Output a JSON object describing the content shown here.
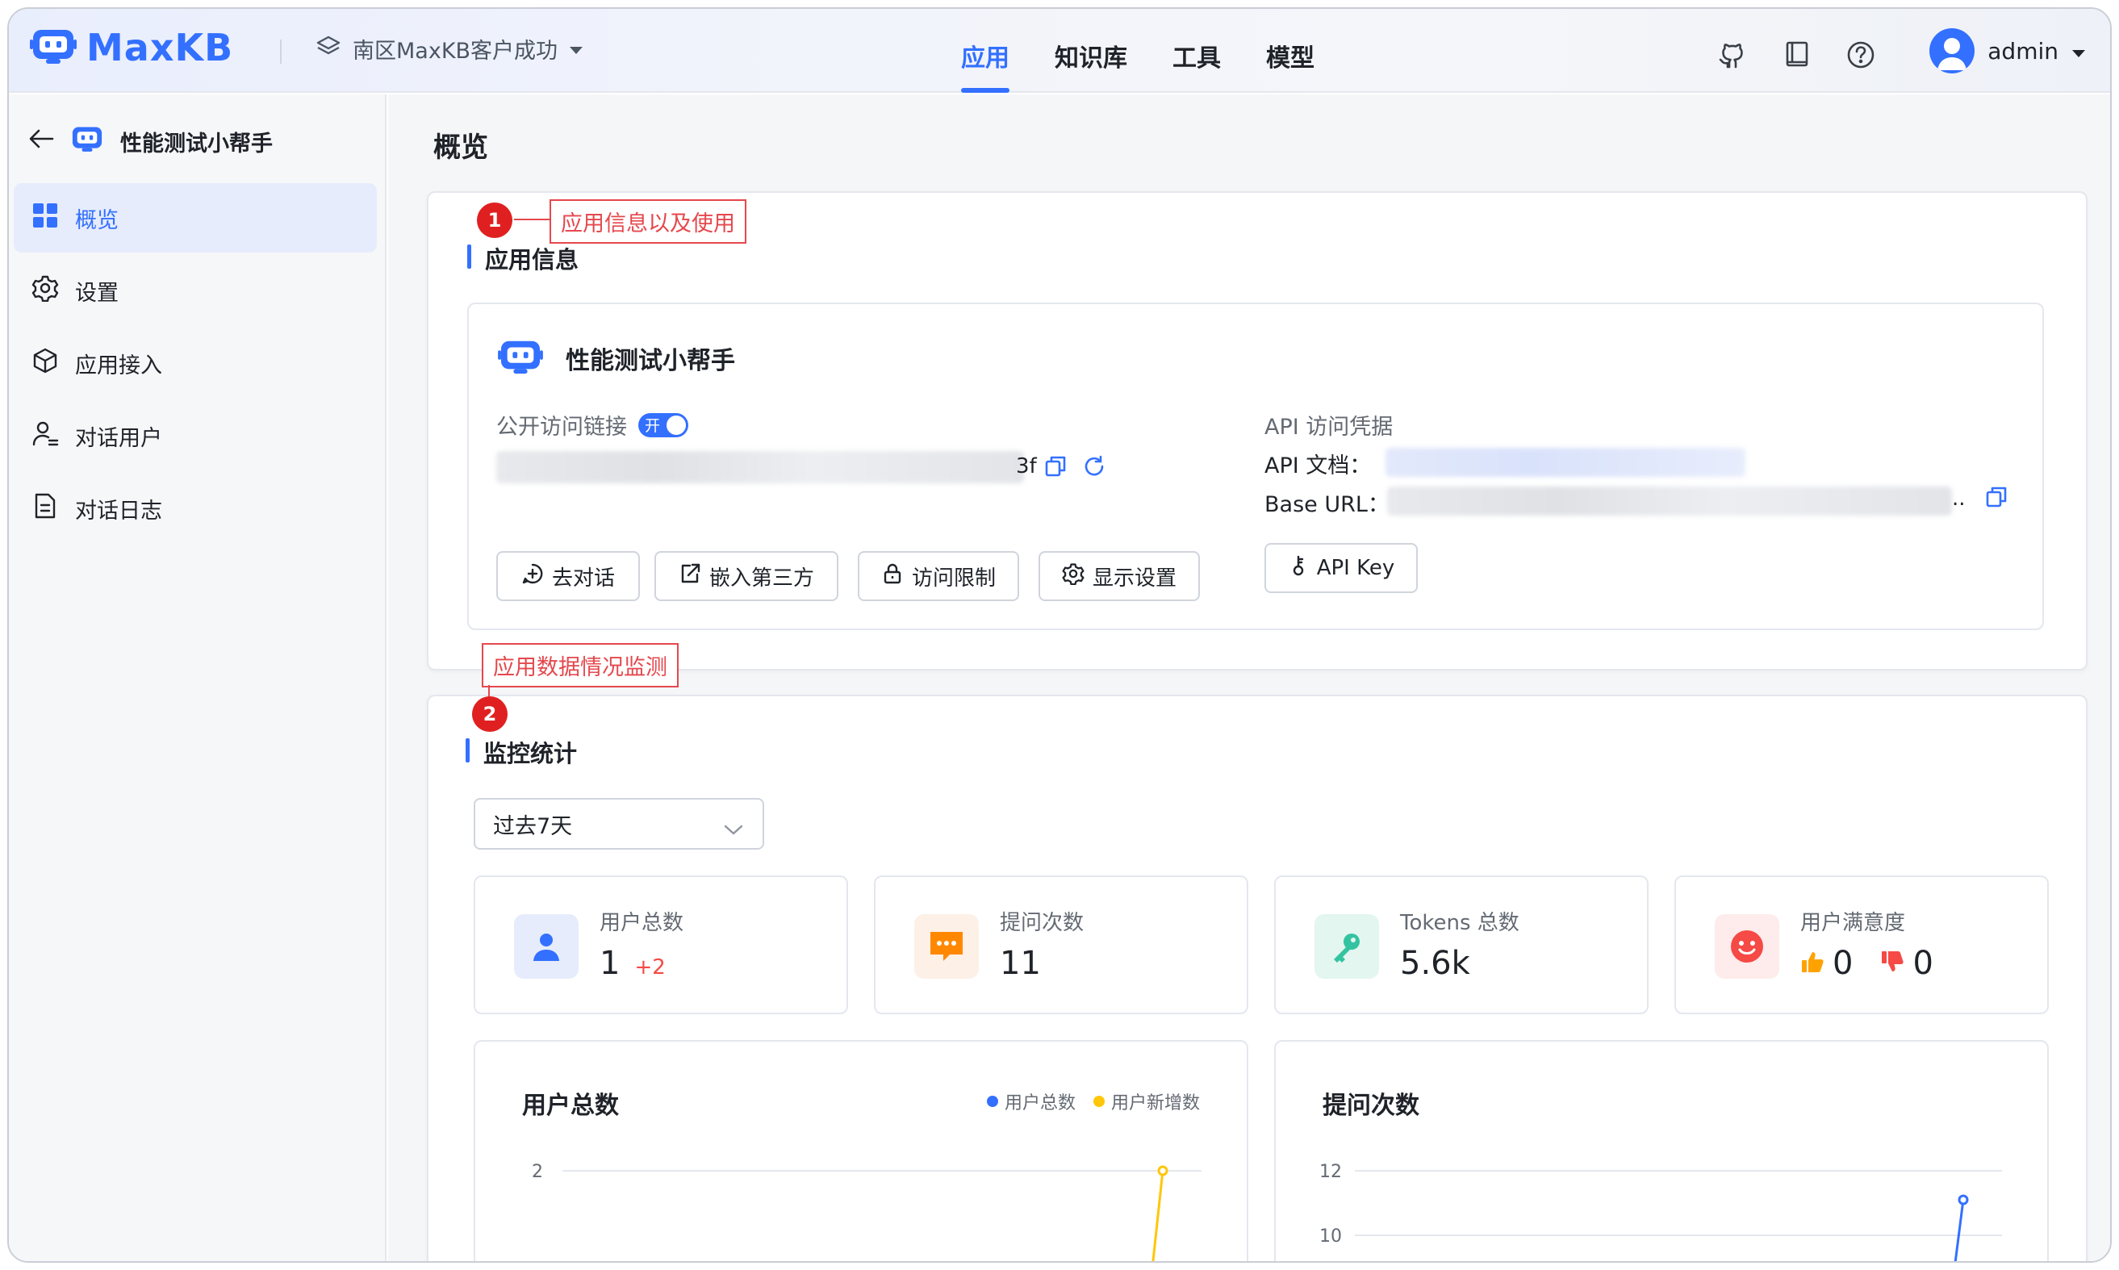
{
  "app": {
    "logo_text": "MaxKB",
    "workspace": "南区MaxKB客户成功"
  },
  "nav": [
    {
      "label": "应用"
    },
    {
      "label": "知识库"
    },
    {
      "label": "工具"
    },
    {
      "label": "模型"
    }
  ],
  "user": {
    "name": "admin"
  },
  "sidebar": {
    "app_name": "性能测试小帮手",
    "items": [
      {
        "label": "概览"
      },
      {
        "label": "设置"
      },
      {
        "label": "应用接入"
      },
      {
        "label": "对话用户"
      },
      {
        "label": "对话日志"
      }
    ]
  },
  "page": {
    "title": "概览"
  },
  "app_info": {
    "section_title": "应用信息",
    "app_name": "性能测试小帮手",
    "public_link_label": "公开访问链接",
    "toggle_label": "开",
    "link_tail": "3f",
    "api_label": "API 访问凭据",
    "api_doc_label": "API 文档：",
    "base_url_label": "Base URL：",
    "base_url_tail": "..",
    "buttons": {
      "chat": "去对话",
      "embed": "嵌入第三方",
      "access": "访问限制",
      "display": "显示设置",
      "api_key": "API Key"
    }
  },
  "annotations": {
    "one": {
      "num": "1",
      "text": "应用信息以及使用"
    },
    "two": {
      "num": "2",
      "text": "应用数据情况监测"
    }
  },
  "monitor": {
    "section_title": "监控统计",
    "range": "过去7天",
    "stats": {
      "users": {
        "label": "用户总数",
        "value": "1",
        "delta": "+2"
      },
      "questions": {
        "label": "提问次数",
        "value": "11"
      },
      "tokens": {
        "label": "Tokens 总数",
        "value": "5.6k"
      },
      "satisfaction": {
        "label": "用户满意度",
        "likes": "0",
        "dislikes": "0"
      }
    }
  },
  "chart_data": [
    {
      "type": "line",
      "title": "用户总数",
      "series": [
        {
          "name": "用户总数",
          "color": "#3370ff"
        },
        {
          "name": "用户新增数",
          "color": "#ffc60a"
        }
      ],
      "y_ticks": [
        "2"
      ]
    },
    {
      "type": "line",
      "title": "提问次数",
      "series": [
        {
          "color": "#3370ff"
        }
      ],
      "y_ticks": [
        "12",
        "10"
      ]
    }
  ]
}
